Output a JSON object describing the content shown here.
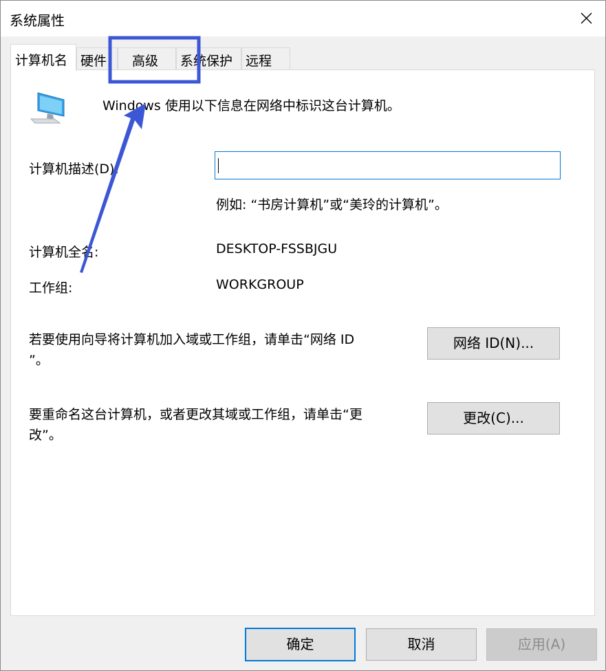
{
  "window": {
    "title": "系统属性"
  },
  "tabs": [
    {
      "label": "计算机名"
    },
    {
      "label": "硬件"
    },
    {
      "label": "高级"
    },
    {
      "label": "系统保护"
    },
    {
      "label": "远程"
    }
  ],
  "header": {
    "description": "Windows 使用以下信息在网络中标识这台计算机。"
  },
  "description_field": {
    "label": "计算机描述(D):",
    "value": "",
    "hint": "例如: “书房计算机”或“美玲的计算机”。"
  },
  "full_name": {
    "label": "计算机全名:",
    "value": "DESKTOP-FSSBJGU"
  },
  "workgroup": {
    "label": "工作组:",
    "value": "WORKGROUP"
  },
  "network_id": {
    "text_line1": "若要使用向导将计算机加入域或工作组，请单击“网络 ID",
    "text_line2": "”。",
    "button": "网络 ID(N)..."
  },
  "rename": {
    "text_line1": "要重命名这台计算机，或者更改其域或工作组，请单击“更",
    "text_line2": "改”。",
    "button": "更改(C)..."
  },
  "footer": {
    "ok": "确定",
    "cancel": "取消",
    "apply": "应用(A)"
  },
  "colors": {
    "accent": "#0078d7",
    "annotation": "#3c57d6"
  }
}
